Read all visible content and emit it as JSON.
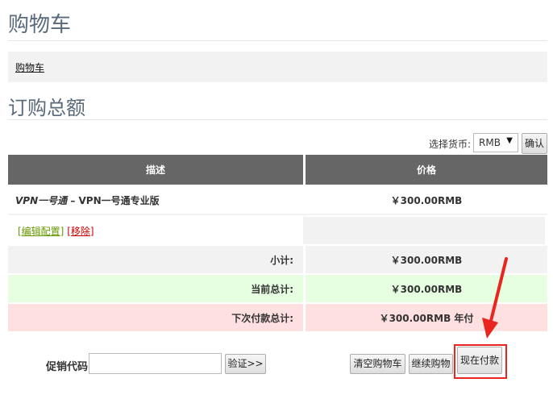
{
  "page_title": "购物车",
  "breadcrumb": "购物车",
  "section_title": "订购总额",
  "currency": {
    "label": "选择货币:",
    "selected": "RMB",
    "confirm": "确认"
  },
  "table": {
    "headers": [
      "描述",
      "价格"
    ],
    "item": {
      "product_italic": "VPN一号通",
      "product_rest": " – VPN一号通专业版",
      "price": "￥300.00RMB"
    },
    "links": {
      "edit": "[编辑配置]",
      "remove": "[移除]"
    },
    "subtotal": {
      "label": "小计:",
      "value": "￥300.00RMB"
    },
    "current_total": {
      "label": "当前总计:",
      "value": "￥300.00RMB"
    },
    "next_total": {
      "label": "下次付款总计:",
      "value": "￥300.00RMB 年付"
    }
  },
  "promo": {
    "label": "促销代码",
    "value": "",
    "verify": "验证>>"
  },
  "actions": {
    "clear": "清空购物车",
    "continue": "继续购物",
    "pay": "现在付款"
  },
  "colors": {
    "annotation": "#e8251e",
    "header_bg": "#666666",
    "current_row": "#e6ffe0",
    "next_row": "#ffe0e0"
  }
}
